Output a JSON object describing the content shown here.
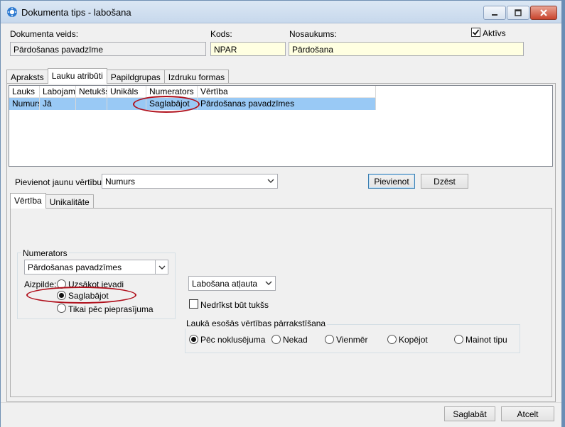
{
  "window": {
    "title": "Dokumenta tips - labošana",
    "app_icon": "gear-app-icon"
  },
  "header": {
    "doc_type_label": "Dokumenta veids:",
    "doc_type_value": "Pārdošanas pavadzīme",
    "code_label": "Kods:",
    "code_value": "NPAR",
    "name_label": "Nosaukums:",
    "name_value": "Pārdošana",
    "active_label": "Aktīvs",
    "active_checked": true
  },
  "main_tabs": [
    {
      "label": "Apraksts",
      "active": false
    },
    {
      "label": "Lauku atribūti",
      "active": true
    },
    {
      "label": "Papildgrupas",
      "active": false
    },
    {
      "label": "Izdruku formas",
      "active": false
    }
  ],
  "grid": {
    "columns": [
      "Lauks",
      "Labojams",
      "Netukšs",
      "Unikāls",
      "Numerators",
      "Vērtība"
    ],
    "rows": [
      [
        "Numurs",
        "Jā",
        "",
        "",
        "Saglabājot",
        "Pārdošanas pavadzīmes"
      ]
    ]
  },
  "add_value": {
    "label": "Pievienot jaunu vērtību:",
    "selected": "Numurs",
    "add_button": "Pievienot",
    "delete_button": "Dzēst"
  },
  "sub_tabs": [
    {
      "label": "Vērtība",
      "active": true
    },
    {
      "label": "Unikalitāte",
      "active": false
    }
  ],
  "numerator": {
    "group_title": "Numerators",
    "selected": "Pārdošanas pavadzīmes",
    "fill_label": "Aizpilde:",
    "options": [
      "Uzsākot ievadi",
      "Saglabājot",
      "Tikai pēc pieprasījuma"
    ],
    "selected_index": 1
  },
  "editing": {
    "selected": "Labošana atļauta",
    "not_empty_label": "Nedrīkst būt tukšs",
    "not_empty_checked": false
  },
  "overwrite": {
    "group_title": "Laukā esošās vērtības pārrakstīšana",
    "options": [
      "Pēc noklusējuma",
      "Nekad",
      "Vienmēr",
      "Kopējot",
      "Mainot tipu"
    ],
    "selected_index": 0
  },
  "footer": {
    "save_button": "Saglabāt",
    "cancel_button": "Atcelt"
  },
  "colors": {
    "selection": "#99c9f5",
    "highlight_ellipse": "#b0101c",
    "input_yellow": "#ffffe1"
  }
}
